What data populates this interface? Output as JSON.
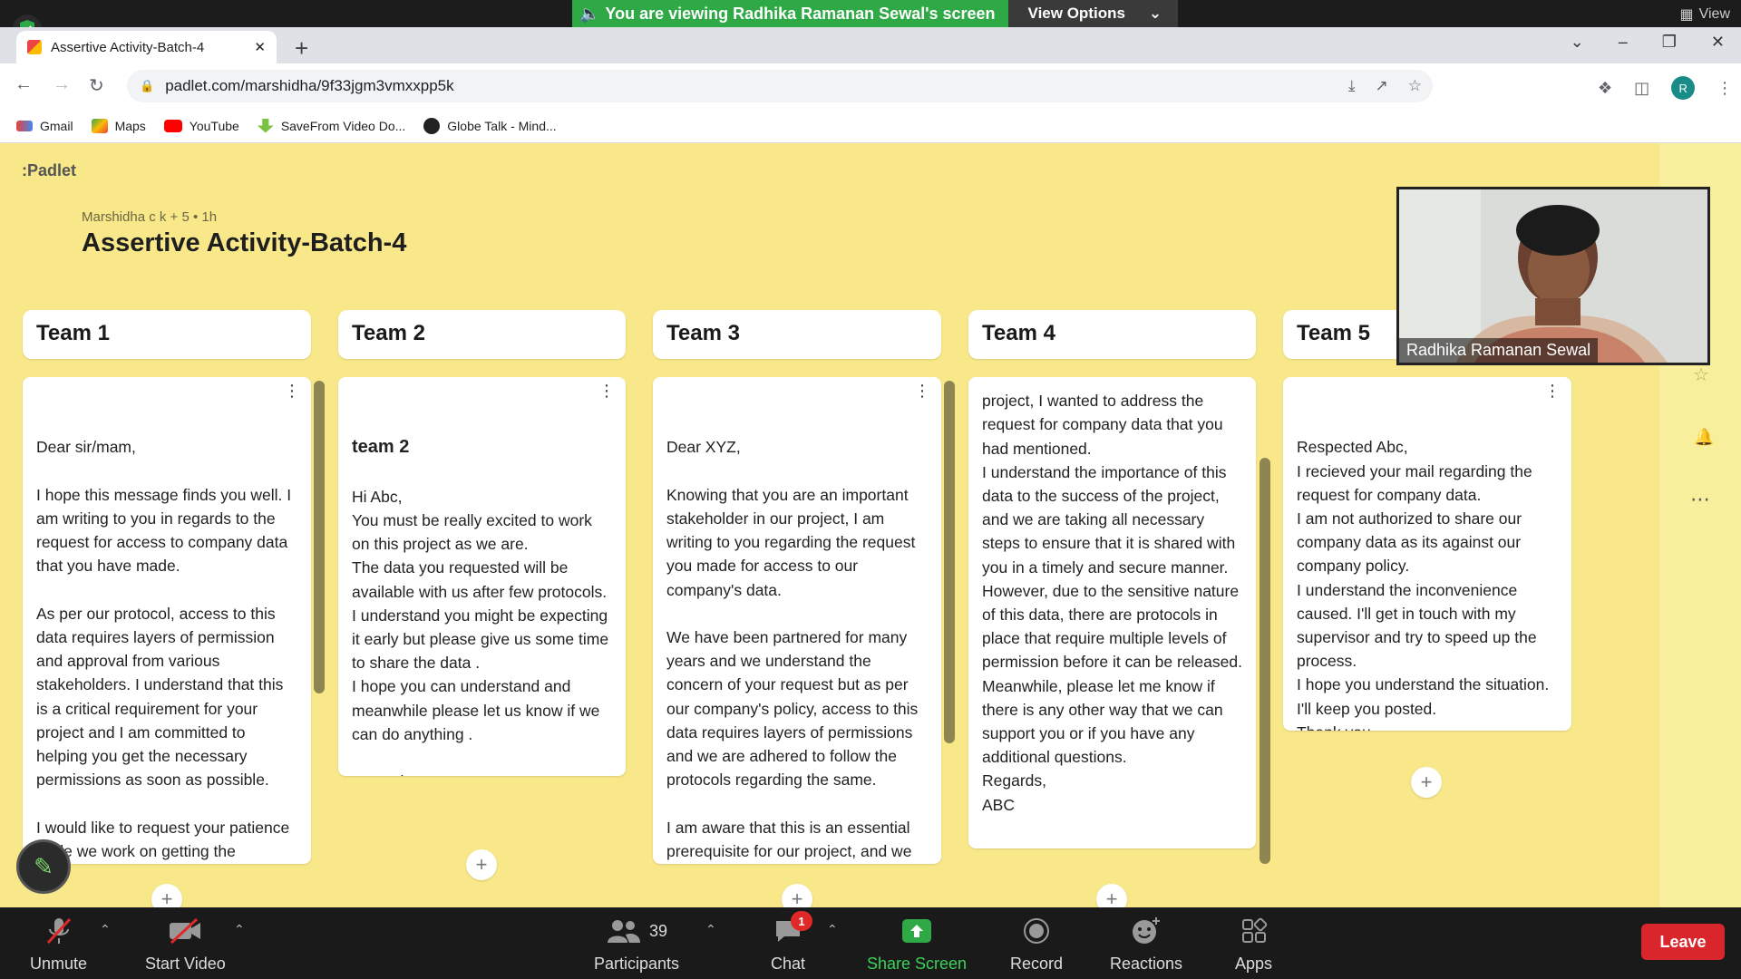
{
  "zoom": {
    "share_banner": "You are viewing Radhika Ramanan Sewal's screen",
    "view_options": "View Options",
    "view_label": "View",
    "unmute": "Unmute",
    "start_video": "Start Video",
    "participants": "Participants",
    "participant_count": "39",
    "chat": "Chat",
    "chat_badge": "1",
    "share_screen": "Share Screen",
    "record": "Record",
    "reactions": "Reactions",
    "apps": "Apps",
    "leave": "Leave",
    "video_name": "Radhika Ramanan Sewal"
  },
  "browser": {
    "tab_title": "Assertive Activity-Batch-4",
    "url": "padlet.com/marshidha/9f33jgm3vmxxpp5k",
    "profile_initial": "R",
    "bookmarks": [
      "Gmail",
      "Maps",
      "YouTube",
      "SaveFrom Video Do...",
      "Globe Talk - Mind..."
    ]
  },
  "padlet": {
    "logo": ":Padlet",
    "meta": "Marshidha c k + 5 • 1h",
    "title": "Assertive Activity-Batch-4",
    "columns": [
      {
        "name": "Team 1"
      },
      {
        "name": "Team 2"
      },
      {
        "name": "Team 3"
      },
      {
        "name": "Team 4"
      },
      {
        "name": "Team 5"
      }
    ],
    "cards": {
      "team1": "Dear sir/mam,\n\nI hope this message finds you well. I am writing to you in regards to the request for access to company data that you have made.\n\nAs per our protocol, access to this data requires layers of permission and approval from various stakeholders. I understand that this is a critical requirement for your project and I am committed to helping you get the necessary permissions as soon as possible.\n\nI would like to request your patience while we work on getting the required approvals. In the meantime, please let me know if",
      "team2_title": "team 2",
      "team2": "Hi Abc,\nYou must be really excited to work on this project as we are.\n    The data you requested will be available with us after few protocols.\n    I understand you might be expecting it early but please give us some time to share the data .\n    I hope you can understand and meanwhile please let us know if we can do anything .\n\nRegards,\nXYZ",
      "team3": "Dear XYZ,\n\nKnowing that you are an important stakeholder in our project, I am writing to you regarding the request you made for access to our company's data.\n\nWe have been partnered for many years and we understand the concern of your request but as per our company's policy, access to this data requires layers of permissions and we are adhered to follow the protocols regarding the same.\n\nI am aware that this is an essential prerequisite for our project, and we have committed to assisting you in",
      "team4": "project, I wanted to address the request for company data that you had mentioned.\nI understand the importance of this data to the success of the project, and we are taking all necessary steps to ensure that it is shared with you in a timely and secure manner. However, due to the sensitive nature of this data, there are protocols in place that require multiple levels of permission before it can be released.\nMeanwhile, please let me know if there is any other way that we can support you or if you have any additional questions.\nRegards,\nABC",
      "team5": "Respected Abc,\nI recieved your mail regarding the request for company data.\nI am not authorized to share our company data as its against our company policy.\nI understand the inconvenience caused.  I'll get in touch with my supervisor and try to speed up the process.\n I hope you understand the situation. I'll keep you posted.\nThank you ,\nXYZ"
    }
  }
}
